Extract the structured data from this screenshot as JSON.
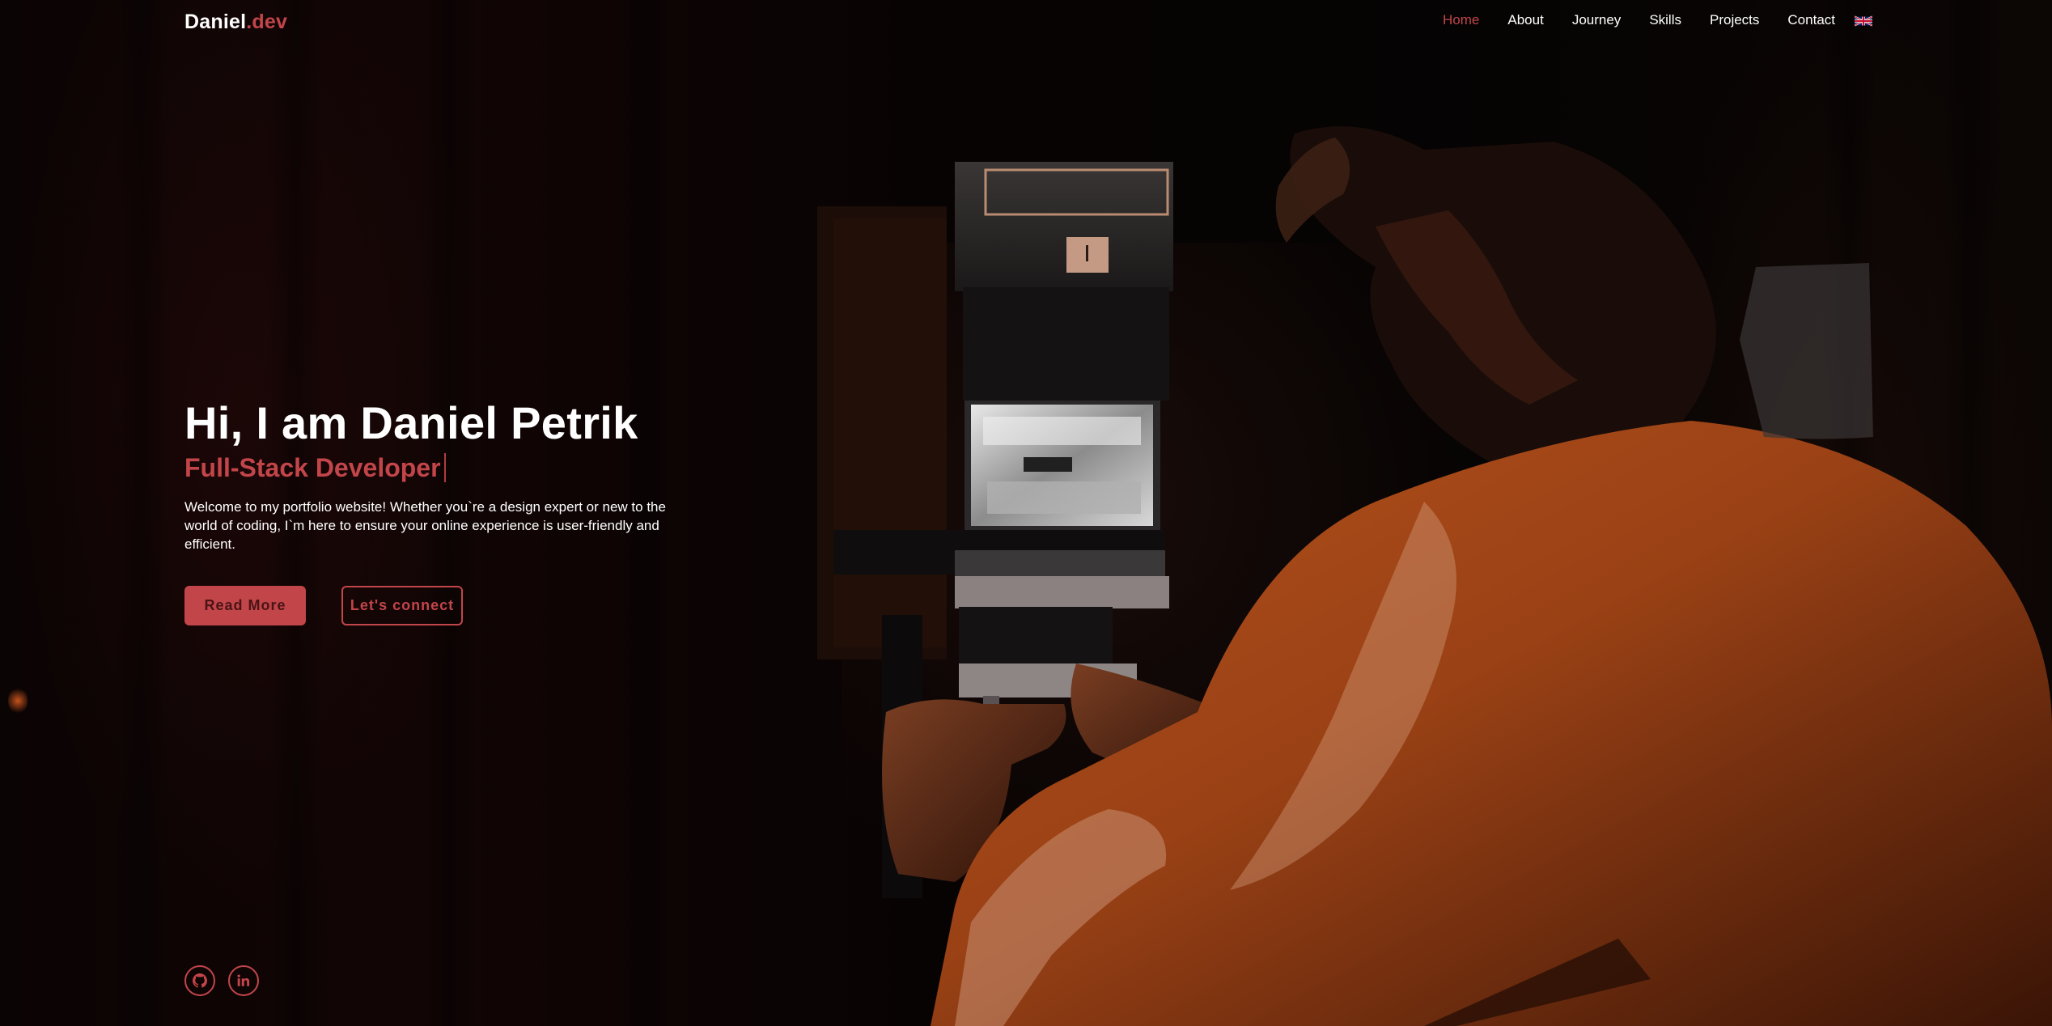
{
  "nav": {
    "logo_name": "Daniel",
    "logo_suffix": ".dev",
    "items": [
      {
        "label": "Home",
        "active": true
      },
      {
        "label": "About",
        "active": false
      },
      {
        "label": "Journey",
        "active": false
      },
      {
        "label": "Skills",
        "active": false
      },
      {
        "label": "Projects",
        "active": false
      },
      {
        "label": "Contact",
        "active": false
      }
    ],
    "language_icon": "uk-flag-icon"
  },
  "hero": {
    "title": "Hi, I am Daniel Petrik",
    "subtitle": "Full-Stack Developer",
    "description": "Welcome to my portfolio website! Whether you`re a design expert or new to the world of coding, I`m here to ensure your online experience is user-friendly and efficient.",
    "primary_button": "Read More",
    "secondary_button": "Let's connect"
  },
  "socials": [
    {
      "icon": "github-icon"
    },
    {
      "icon": "linkedin-icon"
    }
  ],
  "colors": {
    "accent": "#c2454a",
    "background": "#070404",
    "text": "#ffffff"
  }
}
